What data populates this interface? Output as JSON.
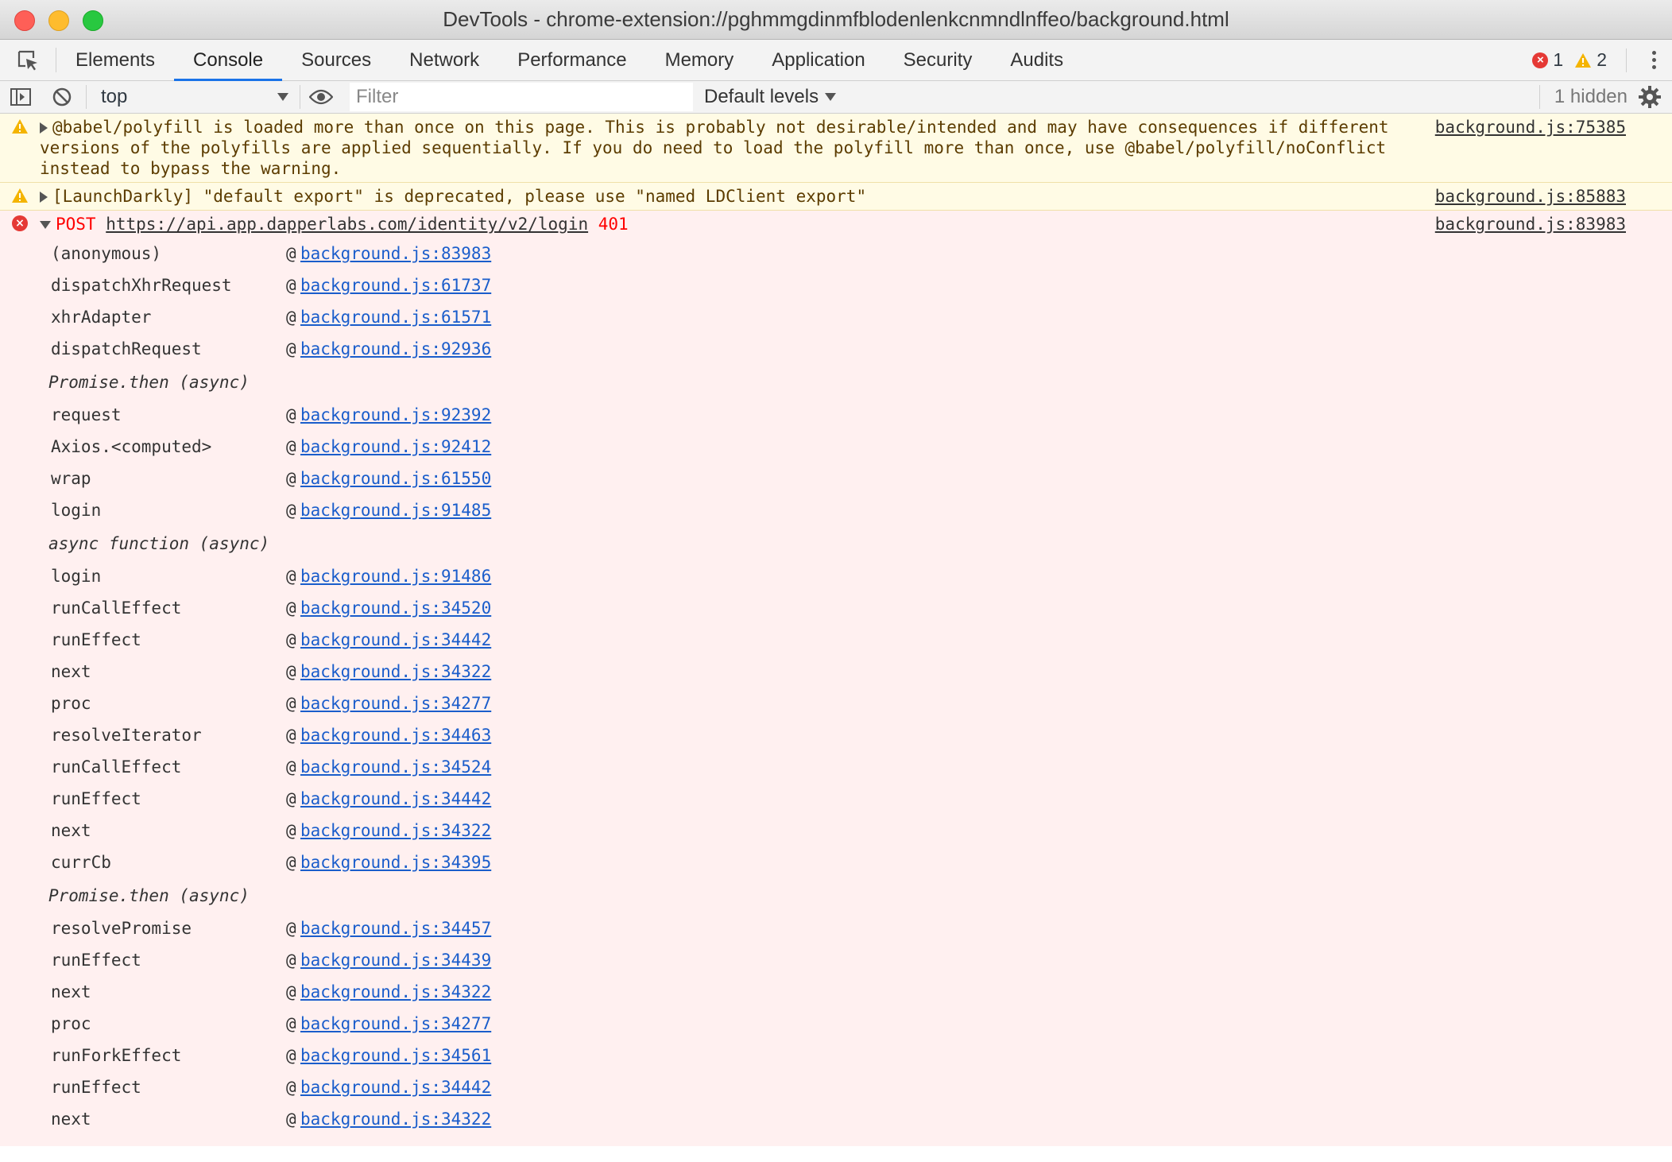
{
  "window": {
    "title": "DevTools - chrome-extension://pghmmgdinmfblodenlenkcnmndlnffeo/background.html"
  },
  "tabs": [
    {
      "label": "Elements"
    },
    {
      "label": "Console",
      "active": true
    },
    {
      "label": "Sources"
    },
    {
      "label": "Network"
    },
    {
      "label": "Performance"
    },
    {
      "label": "Memory"
    },
    {
      "label": "Application"
    },
    {
      "label": "Security"
    },
    {
      "label": "Audits"
    }
  ],
  "counters": {
    "errors": "1",
    "warnings": "2"
  },
  "toolbar": {
    "context": "top",
    "filter_placeholder": "Filter",
    "levels": "Default levels",
    "hidden": "1 hidden"
  },
  "messages": {
    "warn1": {
      "text": "@babel/polyfill is loaded more than once on this page. This is probably not desirable/intended and may have consequences if different versions of the polyfills are applied sequentially. If you do need to load the polyfill more than once, use @babel/polyfill/noConflict instead to bypass the warning.",
      "source": "background.js:75385"
    },
    "warn2": {
      "text": "[LaunchDarkly] \"default export\" is deprecated, please use \"named LDClient export\"",
      "source": "background.js:85883"
    },
    "error": {
      "method": "POST",
      "url": "https://api.app.dapperlabs.com/identity/v2/login",
      "status": "401",
      "source": "background.js:83983"
    }
  },
  "stack": [
    {
      "fn": "(anonymous)",
      "loc": "background.js:83983"
    },
    {
      "fn": "dispatchXhrRequest",
      "loc": "background.js:61737"
    },
    {
      "fn": "xhrAdapter",
      "loc": "background.js:61571"
    },
    {
      "fn": "dispatchRequest",
      "loc": "background.js:92936"
    },
    {
      "async": "Promise.then (async)"
    },
    {
      "fn": "request",
      "loc": "background.js:92392"
    },
    {
      "fn": "Axios.<computed>",
      "loc": "background.js:92412"
    },
    {
      "fn": "wrap",
      "loc": "background.js:61550"
    },
    {
      "fn": "login",
      "loc": "background.js:91485"
    },
    {
      "async": "async function (async)"
    },
    {
      "fn": "login",
      "loc": "background.js:91486"
    },
    {
      "fn": "runCallEffect",
      "loc": "background.js:34520"
    },
    {
      "fn": "runEffect",
      "loc": "background.js:34442"
    },
    {
      "fn": "next",
      "loc": "background.js:34322"
    },
    {
      "fn": "proc",
      "loc": "background.js:34277"
    },
    {
      "fn": "resolveIterator",
      "loc": "background.js:34463"
    },
    {
      "fn": "runCallEffect",
      "loc": "background.js:34524"
    },
    {
      "fn": "runEffect",
      "loc": "background.js:34442"
    },
    {
      "fn": "next",
      "loc": "background.js:34322"
    },
    {
      "fn": "currCb",
      "loc": "background.js:34395"
    },
    {
      "async": "Promise.then (async)"
    },
    {
      "fn": "resolvePromise",
      "loc": "background.js:34457"
    },
    {
      "fn": "runEffect",
      "loc": "background.js:34439"
    },
    {
      "fn": "next",
      "loc": "background.js:34322"
    },
    {
      "fn": "proc",
      "loc": "background.js:34277"
    },
    {
      "fn": "runForkEffect",
      "loc": "background.js:34561"
    },
    {
      "fn": "runEffect",
      "loc": "background.js:34442"
    },
    {
      "fn": "next",
      "loc": "background.js:34322"
    }
  ],
  "colors": {
    "accent": "#1a73e8",
    "error": "#ff0000",
    "warning_bg": "#fffbe5",
    "error_bg": "#fff0f0",
    "link": "#1a5dcb"
  },
  "icons": {
    "inspect": "inspect-element-icon",
    "drawer": "sidebar-toggle-icon",
    "clear": "clear-console-icon",
    "eye": "live-expression-icon",
    "settings": "gear-icon",
    "more": "kebab-menu-icon"
  }
}
